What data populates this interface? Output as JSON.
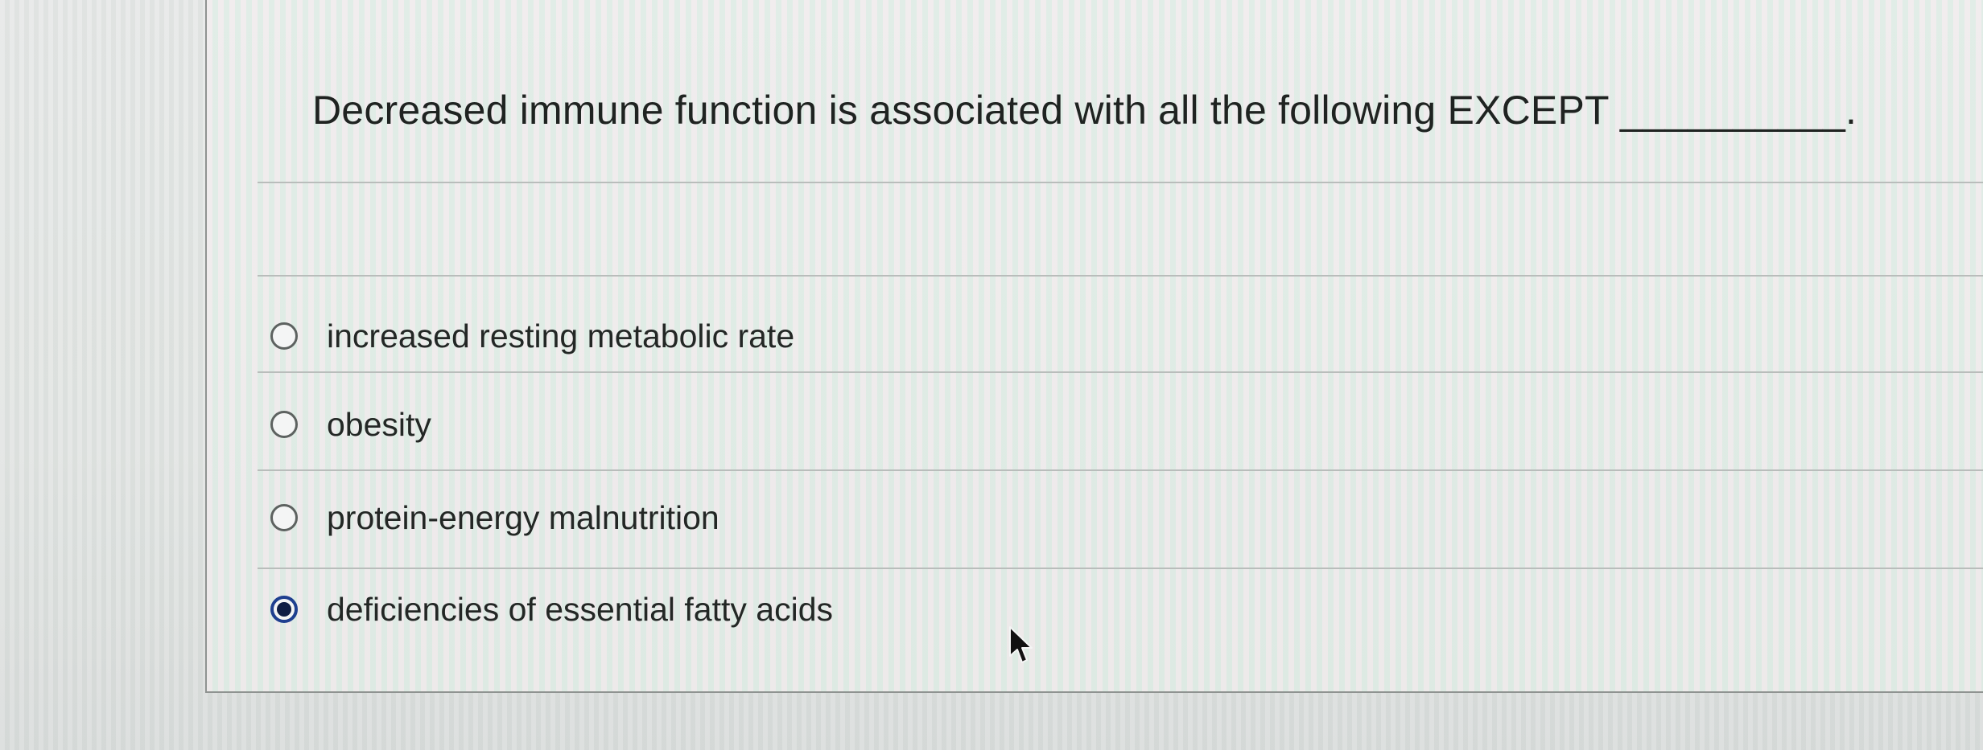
{
  "question": {
    "text": "Decreased immune function is associated with all the following EXCEPT __________."
  },
  "options": [
    {
      "label": "increased resting metabolic rate",
      "selected": false
    },
    {
      "label": "obesity",
      "selected": false
    },
    {
      "label": "protein-energy malnutrition",
      "selected": false
    },
    {
      "label": "deficiencies of essential fatty acids",
      "selected": true
    }
  ],
  "icons": {
    "radio_unselected": "radio-empty-icon",
    "radio_selected": "radio-filled-icon",
    "cursor": "mouse-pointer-icon"
  },
  "colors": {
    "selected_radio": "#1e3f8f",
    "text": "#232725"
  }
}
